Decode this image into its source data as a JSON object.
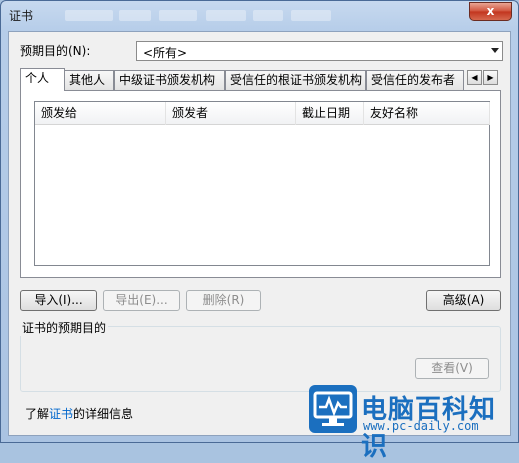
{
  "window": {
    "title": "证书",
    "close_label": "x"
  },
  "purpose": {
    "label": "预期目的(N):",
    "selected": "<所有>"
  },
  "tabs": [
    {
      "label": "个人",
      "active": true
    },
    {
      "label": "其他人",
      "active": false
    },
    {
      "label": "中级证书颁发机构",
      "active": false
    },
    {
      "label": "受信任的根证书颁发机构",
      "active": false
    },
    {
      "label": "受信任的发布者",
      "active": false
    }
  ],
  "tab_scroll": {
    "left": "◀",
    "right": "▶"
  },
  "list": {
    "columns": [
      "颁发给",
      "颁发者",
      "截止日期",
      "友好名称"
    ],
    "rows": []
  },
  "buttons": {
    "import": "导入(I)...",
    "export": "导出(E)...",
    "remove": "删除(R)",
    "advanced": "高级(A)",
    "view": "查看(V)"
  },
  "purposes_group": {
    "title": "证书的预期目的"
  },
  "footer": {
    "prefix": "了解",
    "link": "证书",
    "suffix": "的详细信息"
  },
  "watermark": {
    "name": "电脑百科知识",
    "url": "www.pc-daily.com"
  },
  "colors": {
    "title_bar": "#b6cde9",
    "close_button": "#c2341d",
    "link": "#0066cc",
    "watermark": "#1b6fbf"
  }
}
